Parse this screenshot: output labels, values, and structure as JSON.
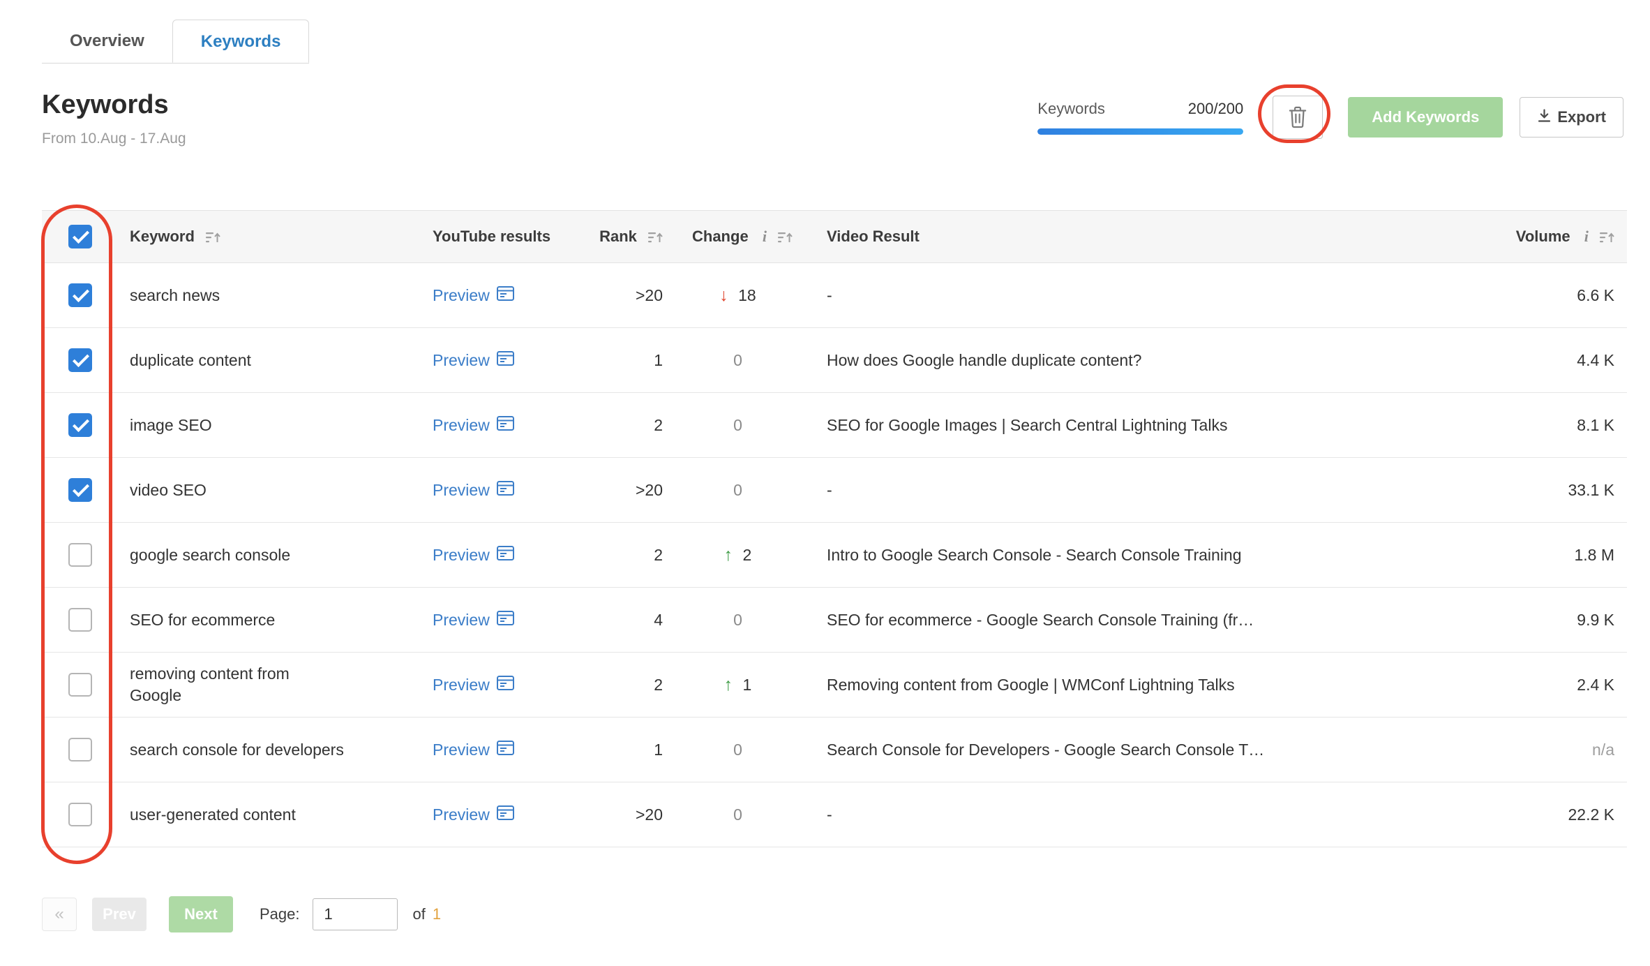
{
  "tabs": [
    {
      "label": "Overview",
      "active": false
    },
    {
      "label": "Keywords",
      "active": true
    }
  ],
  "header": {
    "title": "Keywords",
    "date_range": "From 10.Aug - 17.Aug",
    "keywords_counter": {
      "label": "Keywords",
      "value": "200/200"
    },
    "buttons": {
      "add_keywords": "Add Keywords",
      "export": "Export"
    }
  },
  "table": {
    "columns": {
      "keyword": "Keyword",
      "youtube_results": "YouTube results",
      "rank": "Rank",
      "change": "Change",
      "video_result": "Video Result",
      "volume": "Volume"
    },
    "preview_label": "Preview",
    "select_all_checked": true,
    "rows": [
      {
        "checked": true,
        "keyword": "search news",
        "rank": ">20",
        "change": "18",
        "change_dir": "down",
        "video_result": "-",
        "volume": "6.6 K"
      },
      {
        "checked": true,
        "keyword": "duplicate content",
        "rank": "1",
        "change": "0",
        "change_dir": "none",
        "video_result": "How does Google handle duplicate content?",
        "volume": "4.4 K"
      },
      {
        "checked": true,
        "keyword": "image SEO",
        "rank": "2",
        "change": "0",
        "change_dir": "none",
        "video_result": "SEO for Google Images | Search Central Lightning Talks",
        "volume": "8.1 K"
      },
      {
        "checked": true,
        "keyword": "video SEO",
        "rank": ">20",
        "change": "0",
        "change_dir": "none",
        "video_result": "-",
        "volume": "33.1 K"
      },
      {
        "checked": false,
        "keyword": "google search console",
        "rank": "2",
        "change": "2",
        "change_dir": "up",
        "video_result": "Intro to Google Search Console - Search Console Training",
        "volume": "1.8 M"
      },
      {
        "checked": false,
        "keyword": "SEO for ecommerce",
        "rank": "4",
        "change": "0",
        "change_dir": "none",
        "video_result": "SEO for ecommerce - Google Search Console Training (fr…",
        "volume": "9.9 K"
      },
      {
        "checked": false,
        "keyword": "removing content from Google",
        "rank": "2",
        "change": "1",
        "change_dir": "up",
        "video_result": "Removing content from Google | WMConf Lightning Talks",
        "volume": "2.4 K"
      },
      {
        "checked": false,
        "keyword": "search console for developers",
        "rank": "1",
        "change": "0",
        "change_dir": "none",
        "video_result": "Search Console for Developers - Google Search Console T…",
        "volume": "n/a"
      },
      {
        "checked": false,
        "keyword": "user-generated content",
        "rank": ">20",
        "change": "0",
        "change_dir": "none",
        "video_result": "-",
        "volume": "22.2 K"
      }
    ]
  },
  "pagination": {
    "first_label": "«",
    "prev_label": "Prev",
    "next_label": "Next",
    "page_label": "Page:",
    "page_value": "1",
    "of_label": "of",
    "total_pages": "1"
  },
  "icons": {
    "delete": "trash-icon",
    "export": "download-icon",
    "preview": "serp-preview-icon",
    "sort": "sort-icon",
    "info": "info-icon",
    "first_page": "double-chevron-left-icon"
  },
  "colors": {
    "accent_blue": "#2e7fd9",
    "link_blue": "#3b7dc8",
    "progress_blue": "#2f80e0",
    "button_green": "#a5d69d",
    "annotation_red": "#e8402d",
    "change_up": "#3f9c46",
    "change_down": "#e0442c"
  }
}
